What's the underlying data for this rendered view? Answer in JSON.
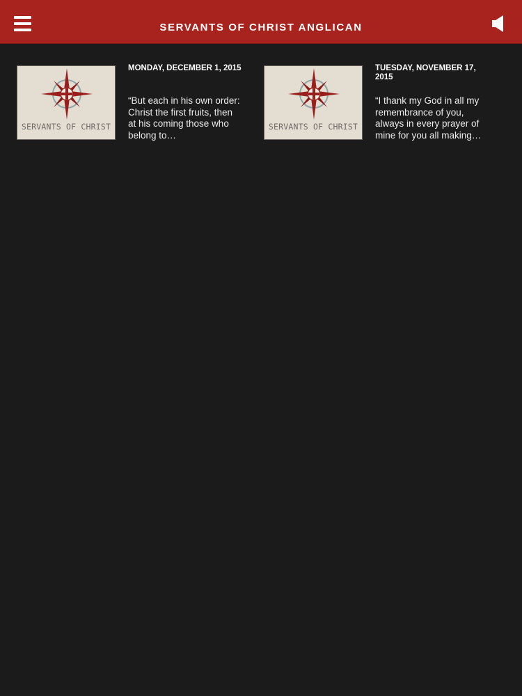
{
  "header": {
    "title": "SERVANTS OF CHRIST ANGLICAN",
    "menu_icon": "hamburger-menu-icon",
    "audio_icon": "speaker-icon"
  },
  "posts": [
    {
      "date": "MONDAY, DECEMBER 1, 2015",
      "excerpt": "“But each in his own order: Christ the first fruits, then at his coming those who belong to…",
      "thumbnail_caption": "SERVANTS OF CHRIST"
    },
    {
      "date": "TUESDAY, NOVEMBER 17, 2015",
      "excerpt": "“I thank my God in all my remembrance of you, always in every prayer of mine for you all making…",
      "thumbnail_caption": "SERVANTS OF CHRIST"
    }
  ],
  "colors": {
    "header_bg": "#a8221e",
    "page_bg": "#1c1b1c",
    "logo_red": "#9a1f1c"
  }
}
